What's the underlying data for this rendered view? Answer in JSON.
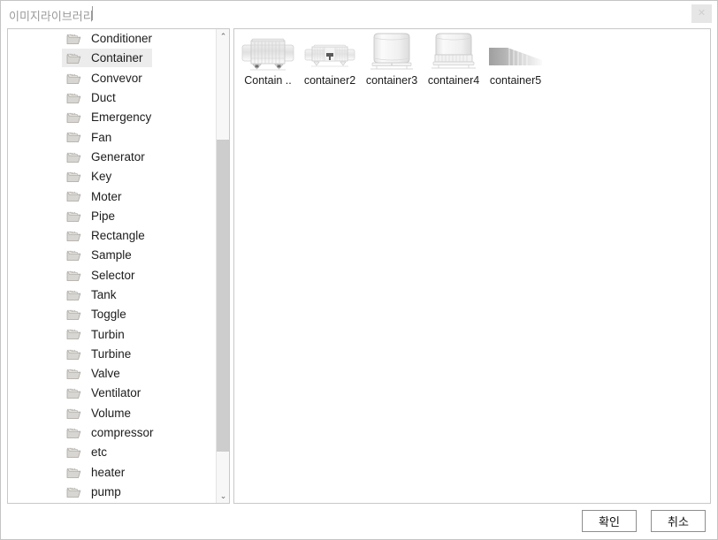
{
  "window": {
    "title": "이미지라이브러리",
    "close_label": "✕"
  },
  "tree": {
    "items": [
      {
        "label": "Conditioner",
        "selected": false
      },
      {
        "label": "Container",
        "selected": true
      },
      {
        "label": "Convevor",
        "selected": false
      },
      {
        "label": "Duct",
        "selected": false
      },
      {
        "label": "Emergency",
        "selected": false
      },
      {
        "label": "Fan",
        "selected": false
      },
      {
        "label": "Generator",
        "selected": false
      },
      {
        "label": "Key",
        "selected": false
      },
      {
        "label": "Moter",
        "selected": false
      },
      {
        "label": "Pipe",
        "selected": false
      },
      {
        "label": "Rectangle",
        "selected": false
      },
      {
        "label": "Sample",
        "selected": false
      },
      {
        "label": "Selector",
        "selected": false
      },
      {
        "label": "Tank",
        "selected": false
      },
      {
        "label": "Toggle",
        "selected": false
      },
      {
        "label": "Turbin",
        "selected": false
      },
      {
        "label": "Turbine",
        "selected": false
      },
      {
        "label": "Valve",
        "selected": false
      },
      {
        "label": "Ventilator",
        "selected": false
      },
      {
        "label": "Volume",
        "selected": false
      },
      {
        "label": "compressor",
        "selected": false
      },
      {
        "label": "etc",
        "selected": false
      },
      {
        "label": "heater",
        "selected": false
      },
      {
        "label": "pump",
        "selected": false
      }
    ],
    "scrollbar": {
      "up_arrow": "⌃",
      "down_arrow": "⌄"
    }
  },
  "thumbnails": {
    "items": [
      {
        "label": "Contain ..",
        "icon": "container1-image"
      },
      {
        "label": "container2",
        "icon": "container2-image"
      },
      {
        "label": "container3",
        "icon": "container3-image"
      },
      {
        "label": "container4",
        "icon": "container4-image"
      },
      {
        "label": "container5",
        "icon": "container5-image"
      }
    ]
  },
  "footer": {
    "ok_label": "확인",
    "cancel_label": "취소"
  },
  "colors": {
    "selection": "#ececec",
    "border": "#c8c8c8",
    "scroll_thumb": "#cdcdcd",
    "title_text": "#9a9a9a"
  }
}
